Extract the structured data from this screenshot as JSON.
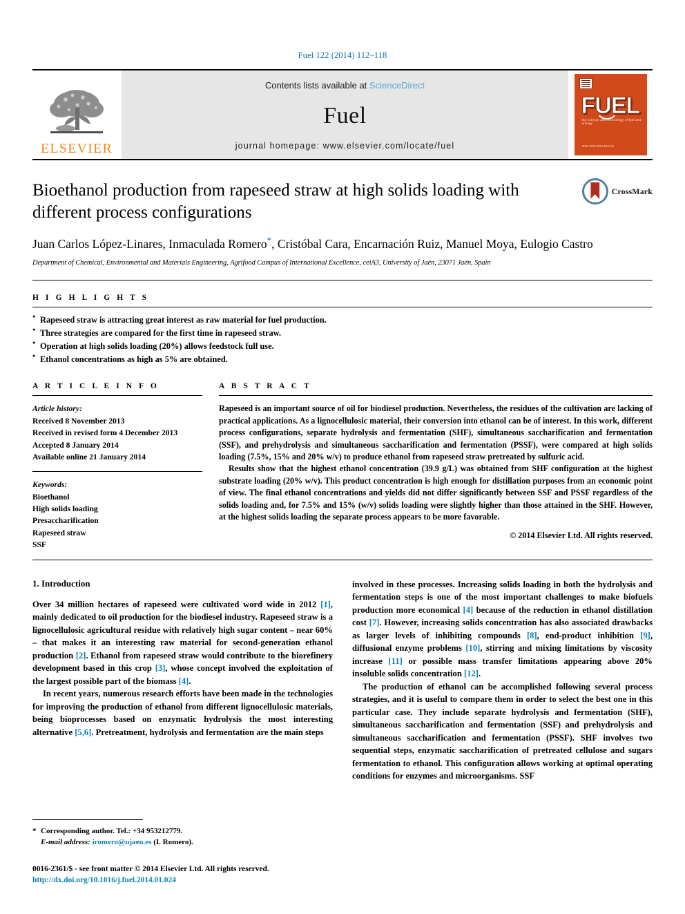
{
  "running_head": "Fuel 122 (2014) 112–118",
  "masthead": {
    "publisher_logo_text": "ELSEVIER",
    "contents_prefix": "Contents lists available at",
    "sciencedirect": "ScienceDirect",
    "journal_name": "Fuel",
    "homepage": "journal homepage: www.elsevier.com/locate/fuel",
    "cover": {
      "title": "FUEL",
      "subtitle": "the science and technology of fuel and energy",
      "footer": "ISSN 0016-2361\nElsevier"
    },
    "accent_link_color": "#5aa9d6"
  },
  "article": {
    "title": "Bioethanol production from rapeseed straw at high solids loading with different process configurations",
    "authors": "Juan Carlos López-Linares, Inmaculada Romero",
    "authors_tail": ", Cristóbal Cara, Encarnación Ruiz, Manuel Moya, Eulogio Castro",
    "corresponding_marker": "*",
    "affiliation": "Department of Chemical, Environmental and Materials Engineering, Agrifood Campus of International Excellence, ceiA3, University of Jaén, 23071 Jaén, Spain",
    "crossmark_label": "CrossMark"
  },
  "highlights": {
    "label": "H I G H L I G H T S",
    "items": [
      "Rapeseed straw is attracting great interest as raw material for fuel production.",
      "Three strategies are compared for the first time in rapeseed straw.",
      "Operation at high solids loading (20%) allows feedstock full use.",
      "Ethanol concentrations as high as 5% are obtained."
    ]
  },
  "article_info": {
    "label": "A R T I C L E   I N F O",
    "history_title": "Article history:",
    "history": [
      "Received 8 November 2013",
      "Received in revised form 4 December 2013",
      "Accepted 8 January 2014",
      "Available online 21 January 2014"
    ],
    "keywords_title": "Keywords:",
    "keywords": [
      "Bioethanol",
      "High solids loading",
      "Presaccharification",
      "Rapeseed straw",
      "SSF"
    ]
  },
  "abstract": {
    "label": "A B S T R A C T",
    "paragraph1": "Rapeseed is an important source of oil for biodiesel production. Nevertheless, the residues of the cultivation are lacking of practical applications. As a lignocellulosic material, their conversion into ethanol can be of interest. In this work, different process configurations, separate hydrolysis and fermentation (SHF), simultaneous saccharification and fermentation (SSF), and prehydrolysis and simultaneous saccharification and fermentation (PSSF), were compared at high solids loading (7.5%, 15% and 20% w/v) to produce ethanol from rapeseed straw pretreated by sulfuric acid.",
    "paragraph2": "Results show that the highest ethanol concentration (39.9 g/L) was obtained from SHF configuration at the highest substrate loading (20% w/v). This product concentration is high enough for distillation purposes from an economic point of view. The final ethanol concentrations and yields did not differ significantly between SSF and PSSF regardless of the solids loading and, for 7.5% and 15% (w/v) solids loading were slightly higher than those attained in the SHF. However, at the highest solids loading the separate process appears to be more favorable.",
    "copyright": "© 2014 Elsevier Ltd. All rights reserved."
  },
  "introduction": {
    "heading": "1. Introduction",
    "left_p1_a": "Over 34 million hectares of rapeseed were cultivated word wide in 2012 ",
    "left_p1_r1": "[1]",
    "left_p1_b": ", mainly dedicated to oil production for the biodiesel industry. Rapeseed straw is a lignocellulosic agricultural residue with relatively high sugar content – near 60% – that makes it an interesting raw material for second-generation ethanol production ",
    "left_p1_r2": "[2]",
    "left_p1_c": ". Ethanol from rapeseed straw would contribute to the biorefinery development based in this crop ",
    "left_p1_r3": "[3]",
    "left_p1_d": ", whose concept involved the exploitation of the largest possible part of the biomass ",
    "left_p1_r4": "[4]",
    "left_p1_e": ".",
    "left_p2_a": "In recent years, numerous research efforts have been made in the technologies for improving the production of ethanol from different lignocellulosic materials, being bioprocesses based on enzymatic hydrolysis the most interesting alternative ",
    "left_p2_r1": "[5,6]",
    "left_p2_b": ". Pretreatment, hydrolysis and fermentation are the main steps",
    "right_p1_a": "involved in these processes. Increasing solids loading in both the hydrolysis and fermentation steps is one of the most important challenges to make biofuels production more economical ",
    "right_p1_r1": "[4]",
    "right_p1_b": " because of the reduction in ethanol distillation cost ",
    "right_p1_r2": "[7]",
    "right_p1_c": ". However, increasing solids concentration has also associated drawbacks as larger levels of inhibiting compounds ",
    "right_p1_r3": "[8]",
    "right_p1_d": ", end-product inhibition ",
    "right_p1_r4": "[9]",
    "right_p1_e": ", diffusional enzyme problems ",
    "right_p1_r5": "[10]",
    "right_p1_f": ", stirring and mixing limitations by viscosity increase ",
    "right_p1_r6": "[11]",
    "right_p1_g": " or possible mass transfer limitations appearing above 20% insoluble solids concentration ",
    "right_p1_r7": "[12]",
    "right_p1_h": ".",
    "right_p2": "The production of ethanol can be accomplished following several process strategies, and it is useful to compare them in order to select the best one in this particular case. They include separate hydrolysis and fermentation (SHF), simultaneous saccharification and fermentation (SSF) and prehydrolysis and simultaneous saccharification and fermentation (PSSF). SHF involves two sequential steps, enzymatic saccharification of pretreated cellulose and sugars fermentation to ethanol. This configuration allows working at optimal operating conditions for enzymes and microorganisms. SSF"
  },
  "footer": {
    "corresponding_star": "*",
    "corresponding_text": "Corresponding author. Tel.: +34 953212779.",
    "email_label": "E-mail address:",
    "email": "iromero@ujaen.es",
    "email_owner": "(I. Romero).",
    "issn_line": "0016-2361/$ - see front matter © 2014 Elsevier Ltd. All rights reserved.",
    "doi": "http://dx.doi.org/10.1016/j.fuel.2014.01.024"
  }
}
